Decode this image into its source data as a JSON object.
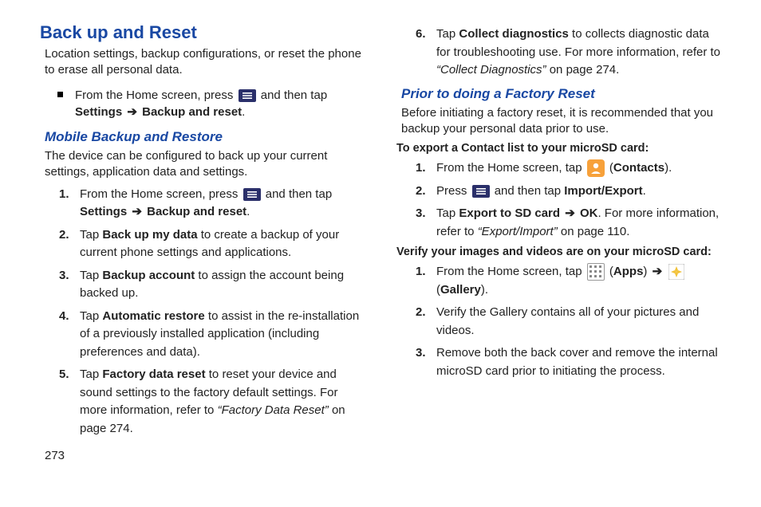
{
  "pageNumber": "273",
  "heading1": "Back up and Reset",
  "intro1": "Location settings, backup configurations, or reset the phone to erase all personal data.",
  "bullet1_pre": "From the Home screen, press ",
  "bullet1_post_a": " and then tap ",
  "bullet1_b1": "Settings",
  "bullet1_b2": "Backup and reset",
  "heading2a": "Mobile Backup and Restore",
  "intro2": "The device can be configured to back up your current settings, application data and settings.",
  "ol_a": {
    "i1_pre": "From the Home screen, press ",
    "i1_post": " and then tap ",
    "i1_b1": "Settings",
    "i1_b2": "Backup and reset",
    "i2_pre": "Tap ",
    "i2_b": "Back up my data",
    "i2_post": " to create a backup of your current phone settings and applications.",
    "i3_pre": "Tap ",
    "i3_b": "Backup account",
    "i3_post": " to assign the account being backed up.",
    "i4_pre": "Tap ",
    "i4_b": "Automatic restore",
    "i4_post": " to assist in the re-installation of a previously installed application (including preferences and data).",
    "i5_pre": "Tap ",
    "i5_b": "Factory data reset",
    "i5_post_a": " to reset your device and sound settings to the factory default settings. For more information, refer to ",
    "i5_ref": "“Factory Data Reset”",
    "i5_post_b": " on page 274.",
    "i6_pre": "Tap ",
    "i6_b": "Collect diagnostics",
    "i6_post_a": " to collects diagnostic data for troubleshooting use. For more information, refer to ",
    "i6_ref": "“Collect Diagnostics”",
    "i6_post_b": " on page 274."
  },
  "heading2b": "Prior to doing a Factory Reset",
  "intro3": "Before initiating a factory reset, it is recommended that you backup your personal data prior to use.",
  "sub1": "To export a Contact list to your microSD card:",
  "ol_b": {
    "i1_pre": "From the Home screen, tap ",
    "i1_post_a": " (",
    "i1_b": "Contacts",
    "i1_post_b": ").",
    "i2_pre": "Press ",
    "i2_post": " and then tap ",
    "i2_b": "Import/Export",
    "i3_pre": "Tap ",
    "i3_b1": "Export to SD card",
    "i3_b2": "OK",
    "i3_post_a": ". For more information, refer to ",
    "i3_ref": "“Export/Import”",
    "i3_post_b": " on page 110."
  },
  "sub2": "Verify your images and videos are on your microSD card:",
  "ol_c": {
    "i1_pre": "From the Home screen, tap ",
    "i1_mid_a": " (",
    "i1_b1": "Apps",
    "i1_mid_b": ") ",
    "i1_post_a": " (",
    "i1_b2": "Gallery",
    "i1_post_b": ").",
    "i2": "Verify the Gallery contains all of your pictures and videos.",
    "i3": "Remove both the back cover and remove the internal microSD card prior to initiating the process."
  },
  "arrow": "➔",
  "period": "."
}
